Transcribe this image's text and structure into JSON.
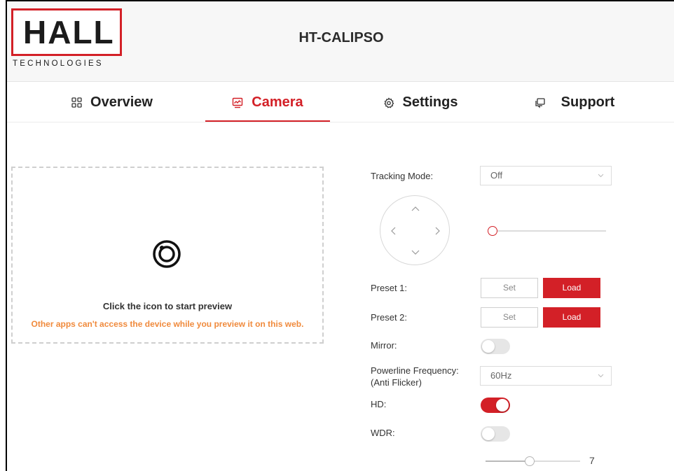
{
  "header": {
    "logo_word": "HALL",
    "logo_sub": "TECHNOLOGIES",
    "device_name": "HT-CALIPSO"
  },
  "tabs": [
    {
      "label": "Overview",
      "icon": "grid-icon",
      "active": false
    },
    {
      "label": "Camera",
      "icon": "monitor-icon",
      "active": true
    },
    {
      "label": "Settings",
      "icon": "gear-icon",
      "active": false
    },
    {
      "label": "Support",
      "icon": "chat-icon",
      "active": false
    }
  ],
  "preview": {
    "icon": "camera-record-icon",
    "title": "Click the icon to start preview",
    "warning": "Other apps can't access the device while you preview it on this web."
  },
  "controls": {
    "tracking_mode": {
      "label": "Tracking Mode:",
      "value": "Off"
    },
    "zoom_slider": {
      "value_fraction": 0.0
    },
    "preset1": {
      "label": "Preset 1:",
      "set": "Set",
      "load": "Load"
    },
    "preset2": {
      "label": "Preset 2:",
      "set": "Set",
      "load": "Load"
    },
    "mirror": {
      "label": "Mirror:",
      "on": false
    },
    "powerline": {
      "label_line1": "Powerline Frequency:",
      "label_line2": "(Anti Flicker)",
      "value": "60Hz"
    },
    "hd": {
      "label": "HD:",
      "on": true
    },
    "wdr": {
      "label": "WDR:",
      "on": false
    },
    "level_slider": {
      "value": "7",
      "value_fraction": 0.47
    }
  },
  "colors": {
    "accent": "#d32027",
    "warning": "#f08a3c"
  }
}
